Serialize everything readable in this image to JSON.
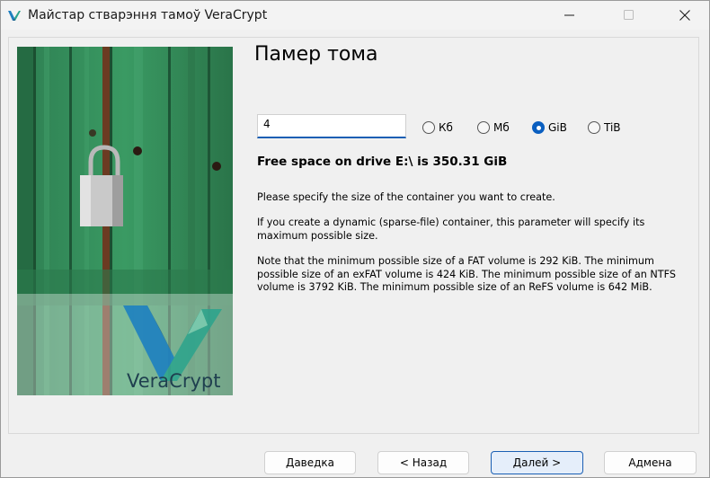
{
  "window": {
    "title": "Майстар стварэння тамоў VeraCrypt"
  },
  "page": {
    "title": "Памер тома"
  },
  "size": {
    "value": "4",
    "units": [
      {
        "label": "Кб",
        "selected": false
      },
      {
        "label": "Мб",
        "selected": false
      },
      {
        "label": "GiB",
        "selected": true
      },
      {
        "label": "TiB",
        "selected": false
      }
    ]
  },
  "free_space": "Free space on drive E:\\ is 350.31 GiB",
  "info": {
    "p1": "Please specify the size of the container you want to create.",
    "p2": "If you create a dynamic (sparse-file) container, this parameter will specify its maximum possible size.",
    "p3": "Note that the minimum possible size of a FAT volume is 292 KiB. The minimum possible size of an exFAT volume is 424 KiB. The minimum possible size of an NTFS volume is 3792 KiB. The minimum possible size of an ReFS volume is 642 MiB."
  },
  "banner": {
    "brand": "VeraCrypt"
  },
  "buttons": {
    "help": "Даведка",
    "back": "< Назад",
    "next": "Далей >",
    "cancel": "Адмена"
  },
  "colors": {
    "accent": "#0a5fc0",
    "door_green": "#2f8a57",
    "logo_blue": "#1d7fc0"
  },
  "icons": {
    "app": "veracrypt-logo-icon",
    "minimize": "minimize-icon",
    "maximize": "maximize-icon",
    "close": "close-icon"
  }
}
